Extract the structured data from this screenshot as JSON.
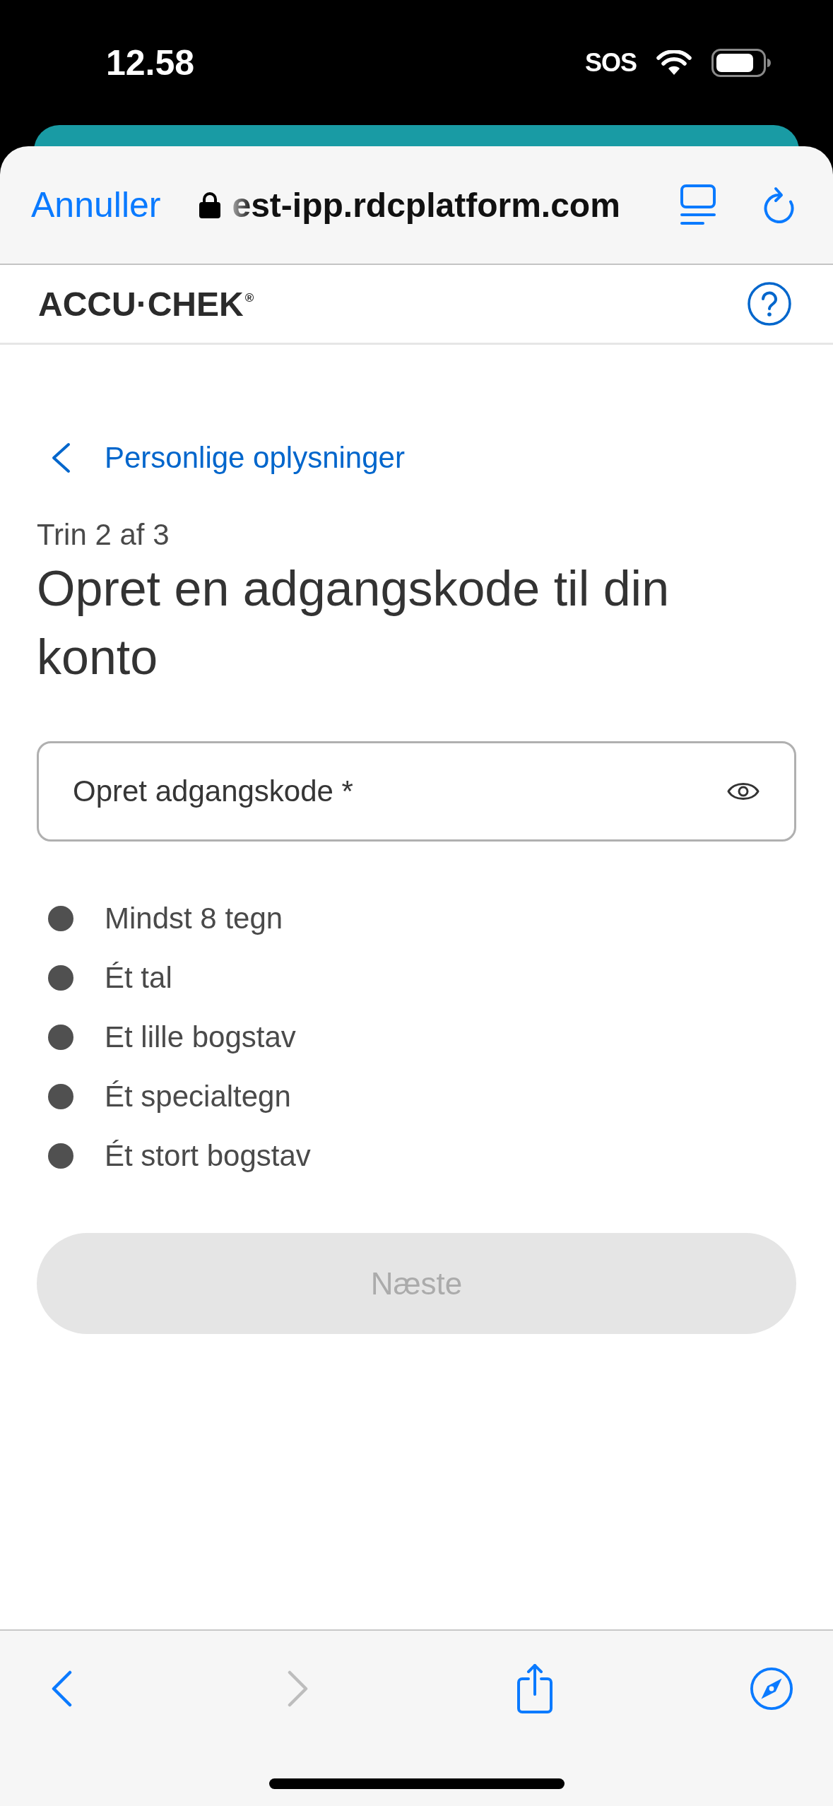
{
  "status_bar": {
    "time": "12.58",
    "network": "SOS"
  },
  "browser": {
    "cancel": "Annuller",
    "url": "est-ipp.rdcplatform.com"
  },
  "site_header": {
    "logo": "ACCU·CHEK$^{®}$"
  },
  "back_link": "Personlige oplysninger",
  "step": "Trin 2 af 3",
  "title": "Opret en adgangskode til din konto",
  "password_field": {
    "placeholder": "Opret adgangskode *"
  },
  "requirements": [
    {
      "label": "Mindst 8 tegn",
      "met": false
    },
    {
      "label": "Ét tal",
      "met": false
    },
    {
      "label": "Et lille bogstav",
      "met": false
    },
    {
      "label": "Ét specialtegn",
      "met": false
    },
    {
      "label": "Ét stort bogstav",
      "met": false
    }
  ],
  "next_button": {
    "label": "Næste",
    "disabled": true
  },
  "toolbar": [
    {
      "kind": "back",
      "disabled": false
    },
    {
      "kind": "forward",
      "disabled": true
    },
    {
      "kind": "share",
      "disabled": false
    },
    {
      "kind": "compass",
      "disabled": false
    }
  ]
}
